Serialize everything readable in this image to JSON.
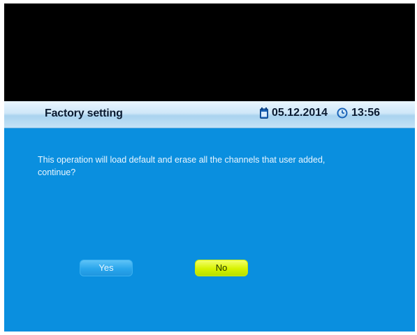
{
  "dialog": {
    "title": "Factory setting",
    "date": "05.12.2014",
    "time": "13:56",
    "message_line1": "This operation will load default and erase all the channels that user added,",
    "message_line2": "continue?"
  },
  "buttons": {
    "yes_label": "Yes",
    "no_label": "No",
    "selected": "No"
  },
  "colors": {
    "background": "#0a8fdf",
    "title_bar": "#cfe7f8",
    "yes_button": "#2aa6ec",
    "no_button_selected": "#d7f200",
    "text": "#eaf6ff"
  },
  "icons": {
    "date": "calendar-icon",
    "time": "clock-icon"
  }
}
